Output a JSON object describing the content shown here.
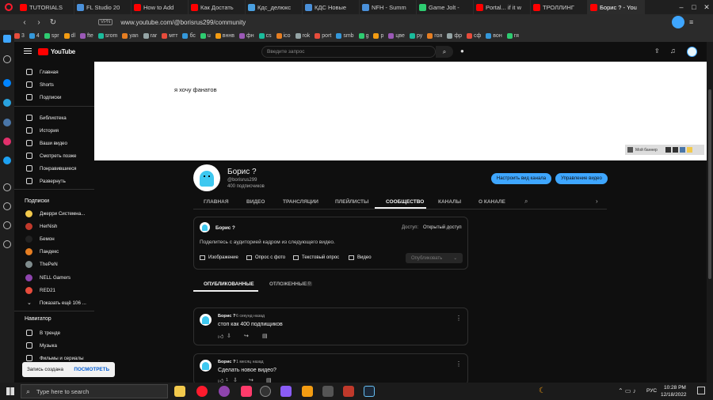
{
  "tabs": [
    {
      "label": "TUTORIALS",
      "color": "#ff0000"
    },
    {
      "label": "FL Studio 20",
      "color": "#4a90d9"
    },
    {
      "label": "How to Add",
      "color": "#ff0000"
    },
    {
      "label": "Как Достать",
      "color": "#ff0000"
    },
    {
      "label": "Кдс_делюкс",
      "color": "#4aa0e0"
    },
    {
      "label": "КДС Новые",
      "color": "#4a90d9"
    },
    {
      "label": "NFH - Summ",
      "color": "#4a90d9"
    },
    {
      "label": "Game Jolt -",
      "color": "#2ecc71"
    },
    {
      "label": "Portal... if it w",
      "color": "#ff0000"
    },
    {
      "label": "ТРОЛЛИНГ",
      "color": "#ff0000"
    },
    {
      "label": "Борис ? - You",
      "color": "#ff0000"
    }
  ],
  "browser": {
    "url": "www.youtube.com/@borisrus299/community",
    "vpn": "VPN"
  },
  "bookmarks": [
    "3",
    "4",
    "spr",
    "dl",
    "fte",
    "srom",
    "yan",
    "rar",
    "мтт",
    "бс",
    "u",
    "вннв",
    "фн",
    "cs",
    "ico",
    "rok",
    "port",
    "smb",
    "g",
    "р",
    "цве",
    "ру",
    "гоя",
    "фр",
    "сф",
    "вон",
    "гя"
  ],
  "youtube": {
    "logo": "YouTube",
    "search_placeholder": "Введите запрос"
  },
  "sidebar": {
    "main": [
      "Главная",
      "Shorts",
      "Подписки"
    ],
    "library": [
      "Библиотека",
      "История",
      "Ваши видео",
      "Смотреть позже",
      "Понравившиеся",
      "Развернуть"
    ],
    "subs_header": "Подписки",
    "subs": [
      {
        "label": "Джерри Системна...",
        "color": "#f2c94c"
      },
      {
        "label": "HerNish",
        "color": "#c0392b"
      },
      {
        "label": "Бемон",
        "color": "#222222"
      },
      {
        "label": "Пандекс",
        "color": "#e67e22"
      },
      {
        "label": "ThePeN",
        "color": "#7f8c8d"
      },
      {
        "label": "NELL Gamers",
        "color": "#8e44ad"
      },
      {
        "label": "RED21",
        "color": "#e74c3c"
      }
    ],
    "show_more": "Показать ещё 106 ...",
    "nav_header": "Навигатор",
    "nav": [
      "В тренде",
      "Музыка",
      "Фильмы и сериалы"
    ]
  },
  "banner": {
    "text": "я хочу фанатов",
    "watermark": "Мой баннер"
  },
  "channel": {
    "name": "Борис ?",
    "handle": "@borisrus299",
    "subs": "400 подписчиков",
    "customize": "Настроить вид канала",
    "manage": "Управление видео"
  },
  "channel_tabs": [
    "ГЛАВНАЯ",
    "ВИДЕО",
    "ТРАНСЛЯЦИИ",
    "ПЛЕЙЛИСТЫ",
    "СООБЩЕСТВО",
    "КАНАЛЫ",
    "О КАНАЛЕ"
  ],
  "composer": {
    "author": "Борис ?",
    "access_label": "Доступ:",
    "access_value": "Открытый доступ",
    "placeholder": "Поделитесь с аудиторией кадром из следующего видео.",
    "image": "Изображение",
    "photo_poll": "Опрос с фото",
    "text_poll": "Текстовый опрос",
    "video": "Видео",
    "publish": "Опубликовать"
  },
  "filters": {
    "published": "ОПУБЛИКОВАННЫЕ",
    "pending": "ОТЛОЖЕННЫЕ",
    "pending_count": "0"
  },
  "posts": [
    {
      "author": "Борис ?",
      "time": "6 секунд назад",
      "text": "стоп как 400 подпищиков",
      "likes": ""
    },
    {
      "author": "Борис ?",
      "time": "1 месяц назад",
      "text": "Сделать новое видео?",
      "likes": "1"
    }
  ],
  "toast": {
    "text": "Запись создана",
    "action": "ПОСМОТРЕТЬ"
  },
  "taskbar": {
    "search": "Type here to search",
    "lang": "РУС",
    "time": "10:28 PM",
    "date": "12/18/2022"
  }
}
